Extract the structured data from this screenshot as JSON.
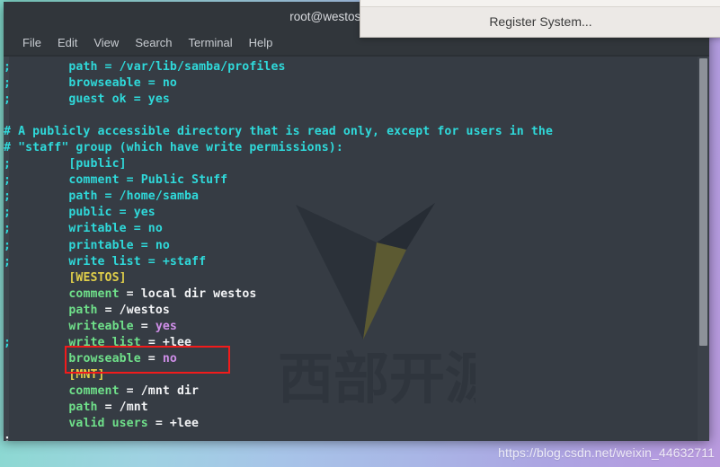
{
  "window": {
    "title": "root@westoslin",
    "menu": [
      "File",
      "Edit",
      "View",
      "Search",
      "Terminal",
      "Help"
    ]
  },
  "dialog": {
    "label": "Register System..."
  },
  "watermark": {
    "url": "https://blog.csdn.net/weixin_44632711",
    "logo_text": "西部开源"
  },
  "colors": {
    "terminal_bg": "#363c44",
    "titlebar_bg": "#31363b",
    "comment": "#2fd9da",
    "section": "#e0cf4a",
    "key": "#6fe08a",
    "plain": "#f2f3f5",
    "value": "#cf8ee8",
    "highlight_box": "#f21b1b",
    "dialog_bg": "#ece9e6"
  },
  "terminal": {
    "prompt": ":",
    "lines": [
      {
        "id": 0,
        "segments": [
          {
            "t": ";        path = /var/lib/samba/profiles",
            "c": "c-comment"
          }
        ]
      },
      {
        "id": 1,
        "segments": [
          {
            "t": ";        browseable = no",
            "c": "c-comment"
          }
        ]
      },
      {
        "id": 2,
        "segments": [
          {
            "t": ";        guest ok = yes",
            "c": "c-comment"
          }
        ]
      },
      {
        "id": 3,
        "segments": [
          {
            "t": "",
            "c": "c-plain"
          }
        ]
      },
      {
        "id": 4,
        "segments": [
          {
            "t": "# A publicly accessible directory that is read only, except for users in the",
            "c": "c-comment"
          }
        ]
      },
      {
        "id": 5,
        "segments": [
          {
            "t": "# \"staff\" group (which have write permissions):",
            "c": "c-comment"
          }
        ]
      },
      {
        "id": 6,
        "segments": [
          {
            "t": ";        [public]",
            "c": "c-comment"
          }
        ]
      },
      {
        "id": 7,
        "segments": [
          {
            "t": ";        comment = Public Stuff",
            "c": "c-comment"
          }
        ]
      },
      {
        "id": 8,
        "segments": [
          {
            "t": ";        path = /home/samba",
            "c": "c-comment"
          }
        ]
      },
      {
        "id": 9,
        "segments": [
          {
            "t": ";        public = yes",
            "c": "c-comment"
          }
        ]
      },
      {
        "id": 10,
        "segments": [
          {
            "t": ";        writable = no",
            "c": "c-comment"
          }
        ]
      },
      {
        "id": 11,
        "segments": [
          {
            "t": ";        printable = no",
            "c": "c-comment"
          }
        ]
      },
      {
        "id": 12,
        "segments": [
          {
            "t": ";        write list = +staff",
            "c": "c-comment"
          }
        ]
      },
      {
        "id": 13,
        "segments": [
          {
            "t": "         ",
            "c": "c-plain"
          },
          {
            "t": "[WESTOS]",
            "c": "c-section"
          }
        ]
      },
      {
        "id": 14,
        "segments": [
          {
            "t": "         ",
            "c": "c-plain"
          },
          {
            "t": "comment",
            "c": "c-key"
          },
          {
            "t": " = local dir westos",
            "c": "c-plain"
          }
        ]
      },
      {
        "id": 15,
        "segments": [
          {
            "t": "         ",
            "c": "c-plain"
          },
          {
            "t": "path",
            "c": "c-key"
          },
          {
            "t": " = /westos",
            "c": "c-plain"
          }
        ]
      },
      {
        "id": 16,
        "segments": [
          {
            "t": "         ",
            "c": "c-plain"
          },
          {
            "t": "writeable",
            "c": "c-key"
          },
          {
            "t": " = ",
            "c": "c-plain"
          },
          {
            "t": "yes",
            "c": "c-val"
          }
        ]
      },
      {
        "id": 17,
        "segments": [
          {
            "t": ";",
            "c": "c-comment"
          },
          {
            "t": "        ",
            "c": "c-plain"
          },
          {
            "t": "write list",
            "c": "c-key"
          },
          {
            "t": " = +lee",
            "c": "c-plain"
          }
        ]
      },
      {
        "id": 18,
        "segments": [
          {
            "t": "         ",
            "c": "c-plain"
          },
          {
            "t": "browseable",
            "c": "c-key"
          },
          {
            "t": " = ",
            "c": "c-plain"
          },
          {
            "t": "no",
            "c": "c-val"
          }
        ]
      },
      {
        "id": 19,
        "segments": [
          {
            "t": "         ",
            "c": "c-plain"
          },
          {
            "t": "[MNT]",
            "c": "c-section"
          }
        ]
      },
      {
        "id": 20,
        "segments": [
          {
            "t": "         ",
            "c": "c-plain"
          },
          {
            "t": "comment",
            "c": "c-key"
          },
          {
            "t": " = /mnt dir",
            "c": "c-plain"
          }
        ]
      },
      {
        "id": 21,
        "segments": [
          {
            "t": "         ",
            "c": "c-plain"
          },
          {
            "t": "path",
            "c": "c-key"
          },
          {
            "t": " = /mnt",
            "c": "c-plain"
          }
        ]
      },
      {
        "id": 22,
        "segments": [
          {
            "t": "         ",
            "c": "c-plain"
          },
          {
            "t": "valid users",
            "c": "c-key"
          },
          {
            "t": " = +lee",
            "c": "c-plain"
          }
        ]
      },
      {
        "id": 23,
        "segments": [
          {
            "t": ":",
            "c": "c-plain"
          }
        ]
      }
    ]
  }
}
